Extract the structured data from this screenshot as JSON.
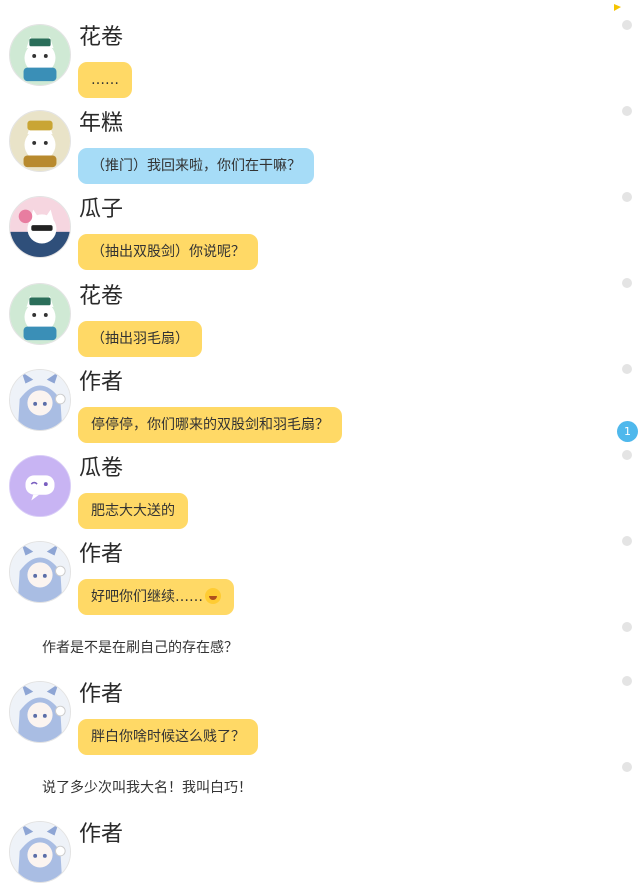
{
  "messages": [
    {
      "name": "花卷",
      "text": "……",
      "color": "yellow",
      "avatar": "cat-green-avatar"
    },
    {
      "name": "年糕",
      "text": "（推门）我回来啦，你们在干嘛？",
      "color": "blue",
      "avatar": "cat-gold-avatar"
    },
    {
      "name": "瓜子",
      "text": "（抽出双股剑）你说呢？",
      "color": "yellow",
      "avatar": "cat-pink-avatar"
    },
    {
      "name": "花卷",
      "text": "（抽出羽毛扇）",
      "color": "yellow",
      "avatar": "cat-green-avatar"
    },
    {
      "name": "作者",
      "text": "停停停，你们哪来的双股剑和羽毛扇？",
      "color": "yellow",
      "avatar": "anime-girl-avatar"
    },
    {
      "name": "瓜卷",
      "text": "肥志大大送的",
      "color": "yellow",
      "avatar": "purple-chat-avatar"
    },
    {
      "name": "作者",
      "text": "好吧你们继续……",
      "emoji": "sweat-smile-emoji",
      "color": "yellow",
      "avatar": "anime-girl-avatar"
    },
    {
      "name": "作者",
      "text": "胖白你啥时候这么贱了？",
      "color": "yellow",
      "avatar": "anime-girl-avatar"
    },
    {
      "name": "作者",
      "text": "",
      "avatar": "anime-girl-avatar"
    }
  ],
  "narrations": [
    "作者是不是在刷自己的存在感？",
    "说了多少次叫我大名！我叫白巧！"
  ],
  "side_badge": "1",
  "colors": {
    "yellow_bubble": "#ffd966",
    "blue_bubble": "#a6dcf7",
    "badge": "#4fb8ec"
  }
}
